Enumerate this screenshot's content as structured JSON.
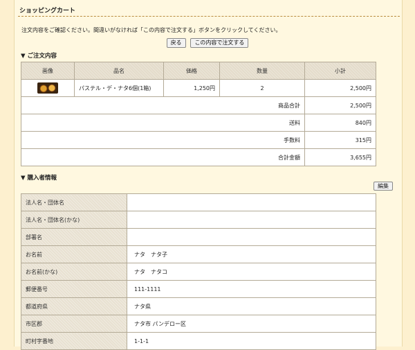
{
  "header": {
    "title": "ショッピングカート"
  },
  "intro": "注文内容をご確認ください。間違いがなければ「この内容で注文する」ボタンをクリックしてください。",
  "buttons": {
    "back": "戻る",
    "confirm": "この内容で注文する",
    "edit": "編集"
  },
  "order": {
    "heading": "▼ ご注文内容",
    "columns": [
      "画像",
      "品名",
      "価格",
      "数量",
      "小計"
    ],
    "items": [
      {
        "image_icon": "pastel-de-nata-thumbnail",
        "name": "パステル・デ・ナタ6個(1箱)",
        "price": "1,250円",
        "qty": "2",
        "subtotal": "2,500円"
      }
    ],
    "summary": [
      {
        "label": "商品合計",
        "value": "2,500円"
      },
      {
        "label": "送料",
        "value": "840円"
      },
      {
        "label": "手数料",
        "value": "315円"
      },
      {
        "label": "合計金額",
        "value": "3,655円"
      }
    ]
  },
  "buyer": {
    "heading": "▼ 購入者情報",
    "rows": [
      {
        "label": "法人名・団体名",
        "value": ""
      },
      {
        "label": "法人名・団体名(かな)",
        "value": ""
      },
      {
        "label": "部署名",
        "value": ""
      },
      {
        "label": "お名前",
        "value": "ナタ　ナタ子"
      },
      {
        "label": "お名前(かな)",
        "value": "ナタ　ナタコ"
      },
      {
        "label": "郵便番号",
        "value": "111-1111"
      },
      {
        "label": "都道府県",
        "value": "ナタ県"
      },
      {
        "label": "市区郡",
        "value": "ナタ市 パンデロー区"
      },
      {
        "label": "町村字番地",
        "value": "1-1-1"
      }
    ]
  }
}
